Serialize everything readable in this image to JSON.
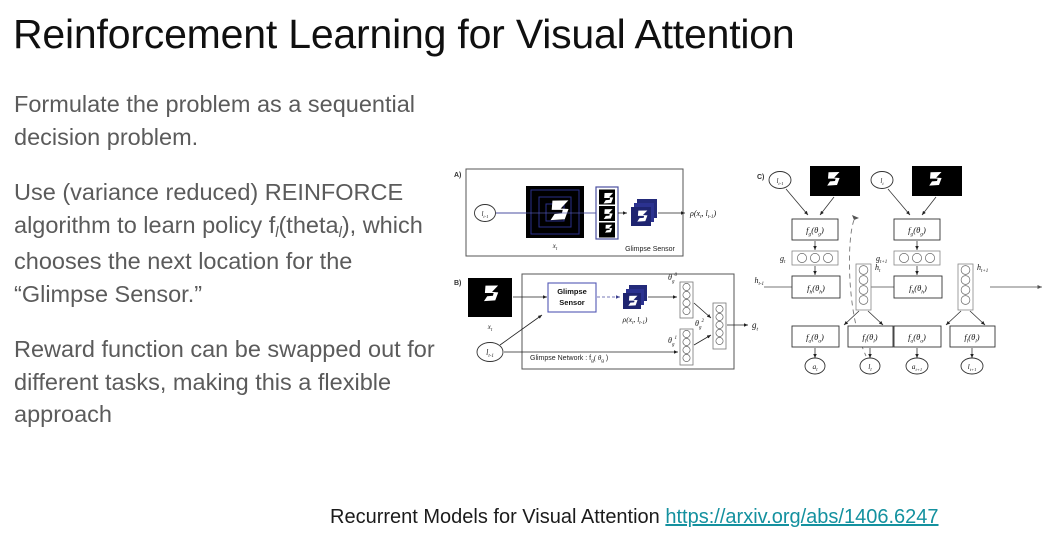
{
  "slide": {
    "title": "Reinforcement Learning for Visual Attention",
    "background_color": "#ffffff",
    "title_color": "#101010",
    "body_color": "#5b5b5b",
    "link_color": "#14919f"
  },
  "body": {
    "paragraph_1": "Formulate the problem as a sequential decision problem.",
    "paragraph_2_part1": "Use (variance reduced) REINFORCE algorithm to learn policy f",
    "paragraph_2_sub1": "l",
    "paragraph_2_part2": "(theta",
    "paragraph_2_sub2": "l",
    "paragraph_2_part3": "), which chooses the next location for the “Glimpse Sensor.”",
    "paragraph_3": "Reward function can be swapped out for different tasks, making this a flexible approach"
  },
  "caption": {
    "text": "Recurrent Models for Visual Attention ",
    "link_text": "https://arxiv.org/abs/1406.6247"
  },
  "figure": {
    "alt": "Recurrent Models of Visual Attention architecture diagram, panels A, B, C",
    "panel_a": {
      "label": "A)",
      "location_node": "l",
      "location_sub": "t-1",
      "image_label": "x",
      "image_sub": "t",
      "sensor_label": "Glimpse Sensor",
      "output_label": "ρ(x",
      "output_sub1": "t",
      "output_mid": ", l",
      "output_sub2": "t-1",
      "output_end": ")"
    },
    "panel_b": {
      "label": "B)",
      "image_label": "x",
      "image_sub": "t",
      "location_node": "l",
      "location_sub": "t-1",
      "sensor_line1": "Glimpse",
      "sensor_line2": "Sensor",
      "rho_label": "ρ(x",
      "rho_sub1": "t",
      "rho_mid": ", l",
      "rho_sub2": "t-1",
      "rho_end": ")",
      "theta_g0": "θ",
      "theta_g0_sub": "g",
      "theta_g0_sup": "0",
      "theta_g1": "θ",
      "theta_g1_sub": "g",
      "theta_g1_sup": "1",
      "theta_g2": "θ",
      "theta_g2_sub": "g",
      "theta_g2_sup": "2",
      "output_label": "g",
      "output_sub": "t",
      "network_label": "Glimpse Network : f",
      "network_sub": "g",
      "network_arg": "( θ",
      "network_arg_sub": "g",
      "network_end": " )"
    },
    "panel_c": {
      "label": "C)",
      "step_t": {
        "location_in": "l",
        "location_in_sub": "t-1",
        "fg": "f",
        "fg_sub": "g",
        "fg_arg": "(θ",
        "fg_arg_sub": "g",
        "fg_end": ")",
        "g_label": "g",
        "g_sub": "t",
        "h_in": "h",
        "h_in_sub": "t-1",
        "fh": "f",
        "fh_sub": "h",
        "fh_arg": "(θ",
        "fh_arg_sub": "h",
        "fh_end": ")",
        "h_out": "h",
        "h_out_sub": "t",
        "fa": "f",
        "fa_sub": "a",
        "fa_arg": "(θ",
        "fa_arg_sub": "a",
        "fa_end": ")",
        "fl": "f",
        "fl_sub": "l",
        "fl_arg": "(θ",
        "fl_arg_sub": "l",
        "fl_end": ")",
        "a_out": "a",
        "a_out_sub": "t",
        "l_out": "l",
        "l_out_sub": "t"
      },
      "step_t1": {
        "location_in": "l",
        "location_in_sub": "t",
        "fg": "f",
        "fg_sub": "g",
        "fg_arg": "(θ",
        "fg_arg_sub": "g",
        "fg_end": ")",
        "g_label": "g",
        "g_sub": "t+1",
        "fh": "f",
        "fh_sub": "h",
        "fh_arg": "(θ",
        "fh_arg_sub": "h",
        "fh_end": ")",
        "h_out": "h",
        "h_out_sub": "t+1",
        "fa": "f",
        "fa_sub": "a",
        "fa_arg": "(θ",
        "fa_arg_sub": "a",
        "fa_end": ")",
        "fl": "f",
        "fl_sub": "l",
        "fl_arg": "(θ",
        "fl_arg_sub": "l",
        "fl_end": ")",
        "a_out": "a",
        "a_out_sub": "t+1",
        "l_out": "l",
        "l_out_sub": "t+1"
      }
    }
  }
}
